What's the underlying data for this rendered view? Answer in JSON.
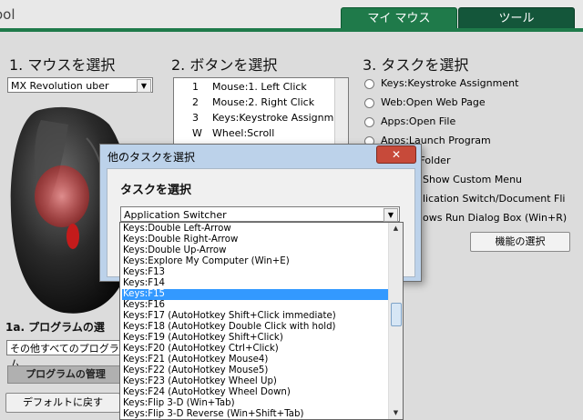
{
  "app": {
    "title_fragment": "ool"
  },
  "tabs": [
    {
      "label": "マイ マウス",
      "active": true
    },
    {
      "label": "ツール",
      "active": false
    }
  ],
  "steps": {
    "select_mouse": "1. マウスを選択",
    "select_button": "2. ボタンを選択",
    "select_task": "3. タスクを選択"
  },
  "mouse_select": {
    "value": "MX Revolution uber"
  },
  "button_list": [
    {
      "key": "1",
      "label": "Mouse:1. Left Click"
    },
    {
      "key": "2",
      "label": "Mouse:2. Right Click"
    },
    {
      "key": "3",
      "label": "Keys:Keystroke Assignme"
    },
    {
      "key": "W",
      "label": "Wheel:Scroll"
    }
  ],
  "task_options": [
    "Keys:Keystroke Assignment",
    "Web:Open Web Page",
    "Apps:Open File",
    "Apps:Launch Program",
    "h Folder",
    "Show Custom Menu",
    "lication Switch/Document Fli",
    "ows Run Dialog Box (Win+R)"
  ],
  "select_function_button": "機能の選択",
  "program_section": {
    "heading": "1a. プログラムの選",
    "select_value": "その他すべてのプログラム",
    "manage_button": "プログラムの管理",
    "reset_button": "デフォルトに戻す"
  },
  "dialog": {
    "title": "他のタスクを選択",
    "close": "✕",
    "heading": "タスクを選択",
    "combo_value": "Application Switcher",
    "list_items": [
      "Keys:Double Left-Arrow",
      "Keys:Double Right-Arrow",
      "Keys:Double Up-Arrow",
      "Keys:Explore My Computer (Win+E)",
      "Keys:F13",
      "Keys:F14",
      "Keys:F15",
      "Keys:F16",
      "Keys:F17 (AutoHotkey Shift+Click immediate)",
      "Keys:F18 (AutoHotkey Double Click with hold)",
      "Keys:F19 (AutoHotkey Shift+Click)",
      "Keys:F20 (AutoHotkey Ctrl+Click)",
      "Keys:F21 (AutoHotkey Mouse4)",
      "Keys:F22 (AutoHotkey Mouse5)",
      "Keys:F23 (AutoHotkey Wheel Up)",
      "Keys:F24 (AutoHotkey Wheel Down)",
      "Keys:Flip 3-D (Win+Tab)",
      "Keys:Flip 3-D Reverse (Win+Shift+Tab)"
    ],
    "selected_index": 6
  },
  "colors": {
    "tab_active": "#1f7a4a",
    "tab_inactive": "#14563a",
    "selection": "#3399ff",
    "close_button": "#c74a3a"
  }
}
